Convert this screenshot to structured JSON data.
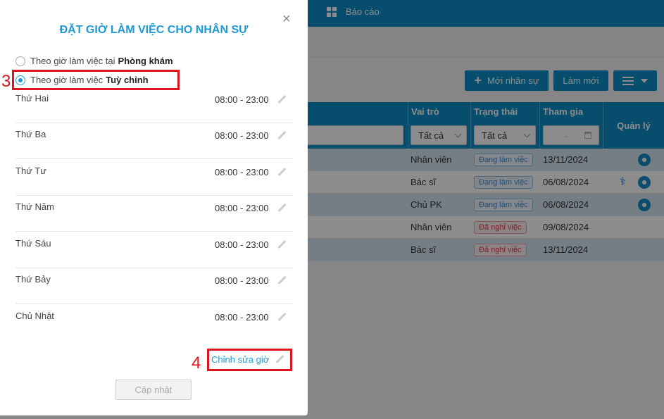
{
  "topnav": {
    "report_label": "Báo cáo"
  },
  "toolbar": {
    "add_staff_label": "Mới nhân sự",
    "refresh_label": "Làm mới"
  },
  "table": {
    "headers": {
      "role": "Vai trò",
      "status": "Trạng thái",
      "join": "Tham gia",
      "manage": "Quản lý"
    },
    "filters": {
      "role_value": "Tất cả",
      "status_value": "Tất cả",
      "date_arrow": "→"
    },
    "rows": [
      {
        "role": "Nhân viên",
        "status": "Đang làm việc",
        "join": "13/11/2024"
      },
      {
        "role": "Bác sĩ",
        "status": "Đang làm việc",
        "join": "06/08/2024"
      },
      {
        "role": "Chủ PK",
        "status": "Đang làm việc",
        "join": "06/08/2024"
      },
      {
        "role": "Nhân viên",
        "status": "Đã nghỉ việc",
        "join": "09/08/2024"
      },
      {
        "role": "Bác sĩ",
        "status": "Đã nghỉ việc",
        "join": "13/11/2024"
      }
    ]
  },
  "modal": {
    "close_glyph": "×",
    "title": "ĐẶT GIỜ LÀM VIỆC CHO NHÂN SỰ",
    "option_clinic_prefix": "Theo giờ làm việc tại",
    "option_clinic_bold": "Phòng khám",
    "option_custom_prefix": "Theo giờ làm việc",
    "option_custom_bold": "Tuỳ chỉnh",
    "days": [
      {
        "name": "Thứ Hai",
        "time": "08:00 - 23:00"
      },
      {
        "name": "Thứ Ba",
        "time": "08:00 - 23:00"
      },
      {
        "name": "Thứ Tư",
        "time": "08:00 - 23:00"
      },
      {
        "name": "Thứ Năm",
        "time": "08:00 - 23:00"
      },
      {
        "name": "Thứ Sáu",
        "time": "08:00 - 23:00"
      },
      {
        "name": "Thứ Bảy",
        "time": "08:00 - 23:00"
      },
      {
        "name": "Chủ Nhật",
        "time": "08:00 - 23:00"
      }
    ],
    "edit_hours_label": "Chỉnh sửa giờ",
    "update_label": "Cập nhật"
  },
  "annotations": {
    "step3": "3",
    "step4": "4",
    "color": "#e0141e"
  }
}
